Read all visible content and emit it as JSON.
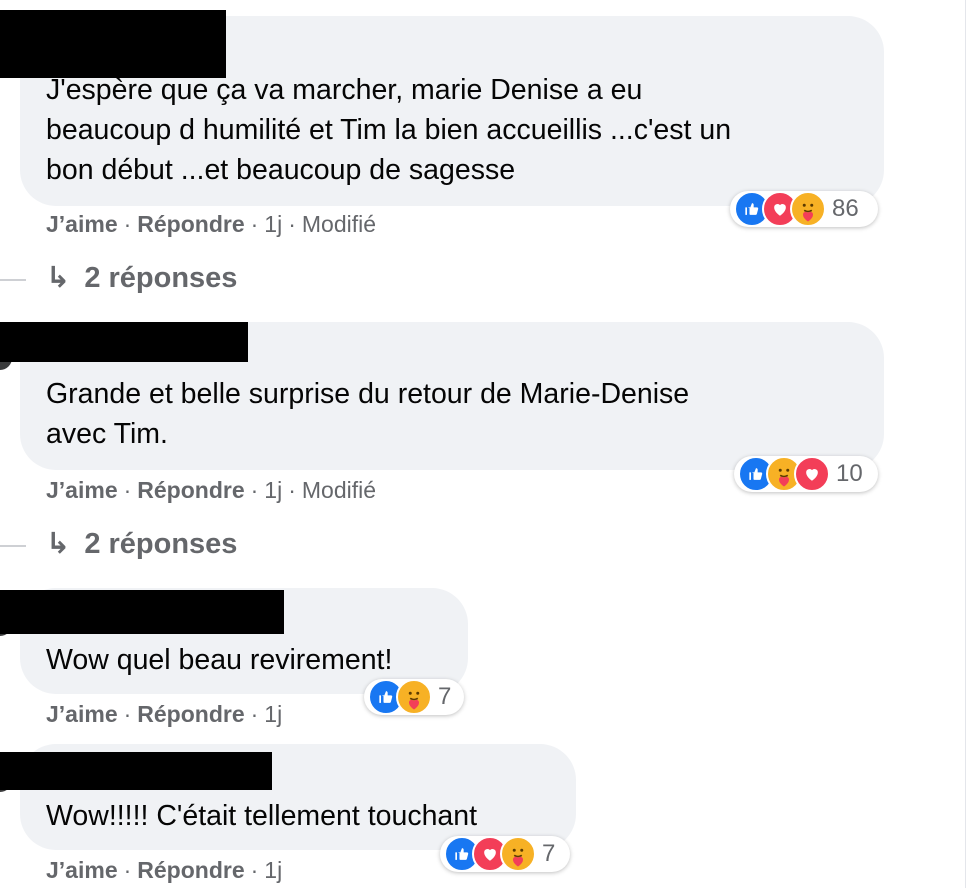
{
  "comments": [
    {
      "text_lines": [
        "J'espère que ça va marcher, marie Denise a eu",
        "beaucoup d humilité et Tim la bien accueillis ...c'est un",
        "bon début ...et beaucoup de sagesse"
      ],
      "like_label": "J’aime",
      "reply_label": "Répondre",
      "time": "1j",
      "edited": "Modifié",
      "reaction_count": "86",
      "reactions": [
        "like-icon",
        "love-icon",
        "care-icon"
      ],
      "replies_label": "2 réponses"
    },
    {
      "text_lines": [
        "Grande et belle surprise du retour de Marie-Denise",
        "avec Tim."
      ],
      "like_label": "J’aime",
      "reply_label": "Répondre",
      "time": "1j",
      "edited": "Modifié",
      "reaction_count": "10",
      "reactions": [
        "like-icon",
        "care-icon",
        "love-icon"
      ],
      "replies_label": "2 réponses"
    },
    {
      "text_lines": [
        "Wow quel beau revirement!"
      ],
      "like_label": "J’aime",
      "reply_label": "Répondre",
      "time": "1j",
      "reaction_count": "7",
      "reactions": [
        "like-icon",
        "care-icon"
      ]
    },
    {
      "text_lines": [
        "Wow!!!!! C'était tellement touchant"
      ],
      "like_label": "J’aime",
      "reply_label": "Répondre",
      "time": "1j",
      "reaction_count": "7",
      "reactions": [
        "like-icon",
        "love-icon",
        "care-icon"
      ]
    }
  ],
  "separator": "·",
  "reply_arrow": "↳",
  "colors": {
    "bubble": "#f0f2f5",
    "meta_text": "#65676b",
    "like": "#1877f2",
    "love": "#f33e58",
    "care": "#f7b125"
  }
}
